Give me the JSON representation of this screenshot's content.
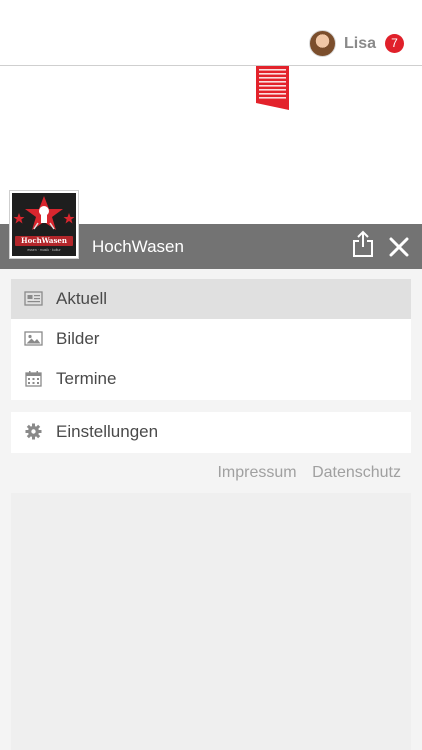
{
  "user": {
    "name": "Lisa",
    "notification_count": "7"
  },
  "header": {
    "title": "HochWasen",
    "share_icon": "share-icon",
    "close_icon": "close-icon"
  },
  "logo": {
    "word": "HochWasen",
    "tagline": "essen · musik · kultur"
  },
  "menu": {
    "primary": [
      {
        "label": "Aktuell",
        "icon": "news-icon",
        "active": true
      },
      {
        "label": "Bilder",
        "icon": "image-icon",
        "active": false
      },
      {
        "label": "Termine",
        "icon": "calendar-icon",
        "active": false
      }
    ],
    "secondary": [
      {
        "label": "Einstellungen",
        "icon": "gear-icon",
        "active": false
      }
    ]
  },
  "links": {
    "impressum": "Impressum",
    "datenschutz": "Datenschutz"
  },
  "colors": {
    "accent_red": "#e0202a",
    "header_bar": "#737373",
    "active_row": "#e0e0e0"
  }
}
